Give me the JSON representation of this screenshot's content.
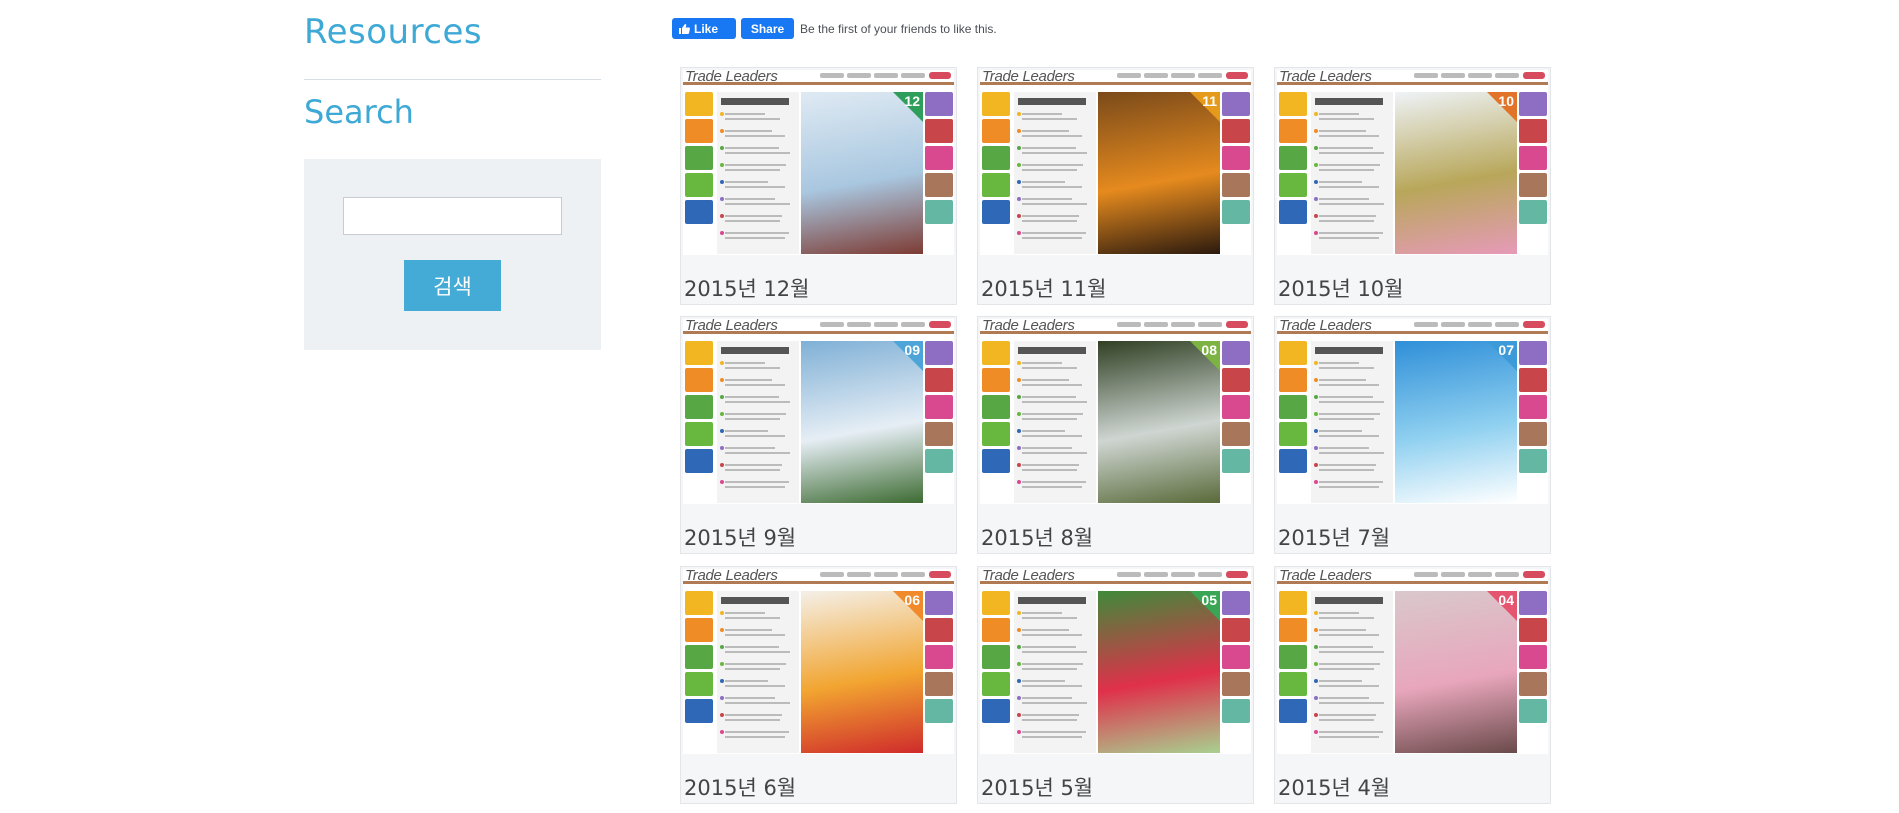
{
  "sidebar": {
    "resources_heading": "Resources",
    "search_heading": "Search",
    "search_input_value": "",
    "search_button_label": "검색"
  },
  "facebook": {
    "like_label": "Like",
    "share_label": "Share",
    "social_text": "Be the first of your friends to like this."
  },
  "cover": {
    "brand": "Trade Leaders"
  },
  "issues": [
    {
      "label": "2015년 12월",
      "number": "12",
      "badge_color": "#2e9e5a",
      "photo_colors": [
        "#dfeaf3",
        "#a9c7e0",
        "#7d3b33"
      ]
    },
    {
      "label": "2015년 11월",
      "number": "11",
      "badge_color": "#e59a1c",
      "photo_colors": [
        "#7a4a1a",
        "#e58a1e",
        "#2b1a0e"
      ]
    },
    {
      "label": "2015년 10월",
      "number": "10",
      "badge_color": "#e2742a",
      "photo_colors": [
        "#eef3f7",
        "#b8a75a",
        "#e69ab8"
      ]
    },
    {
      "label": "2015년 9월",
      "number": "09",
      "badge_color": "#4ca4d8",
      "photo_colors": [
        "#7fb0d6",
        "#e6eef5",
        "#3d6b32"
      ]
    },
    {
      "label": "2015년 8월",
      "number": "08",
      "badge_color": "#7cb342",
      "photo_colors": [
        "#304024",
        "#cfd6d2",
        "#5a6a3a"
      ]
    },
    {
      "label": "2015년 7월",
      "number": "07",
      "badge_color": "#3d9ad9",
      "photo_colors": [
        "#2f8fd8",
        "#8fd0f0",
        "#ffffff"
      ]
    },
    {
      "label": "2015년 6월",
      "number": "06",
      "badge_color": "#f08a2a",
      "photo_colors": [
        "#f4f0e8",
        "#f2a531",
        "#cf2b2b"
      ]
    },
    {
      "label": "2015년 5월",
      "number": "05",
      "badge_color": "#3aa655",
      "photo_colors": [
        "#3f8a3a",
        "#e0304a",
        "#a8d090"
      ]
    },
    {
      "label": "2015년 4월",
      "number": "04",
      "badge_color": "#e5556f",
      "photo_colors": [
        "#d9c8cc",
        "#e8a6bc",
        "#6a4a4a"
      ]
    }
  ]
}
